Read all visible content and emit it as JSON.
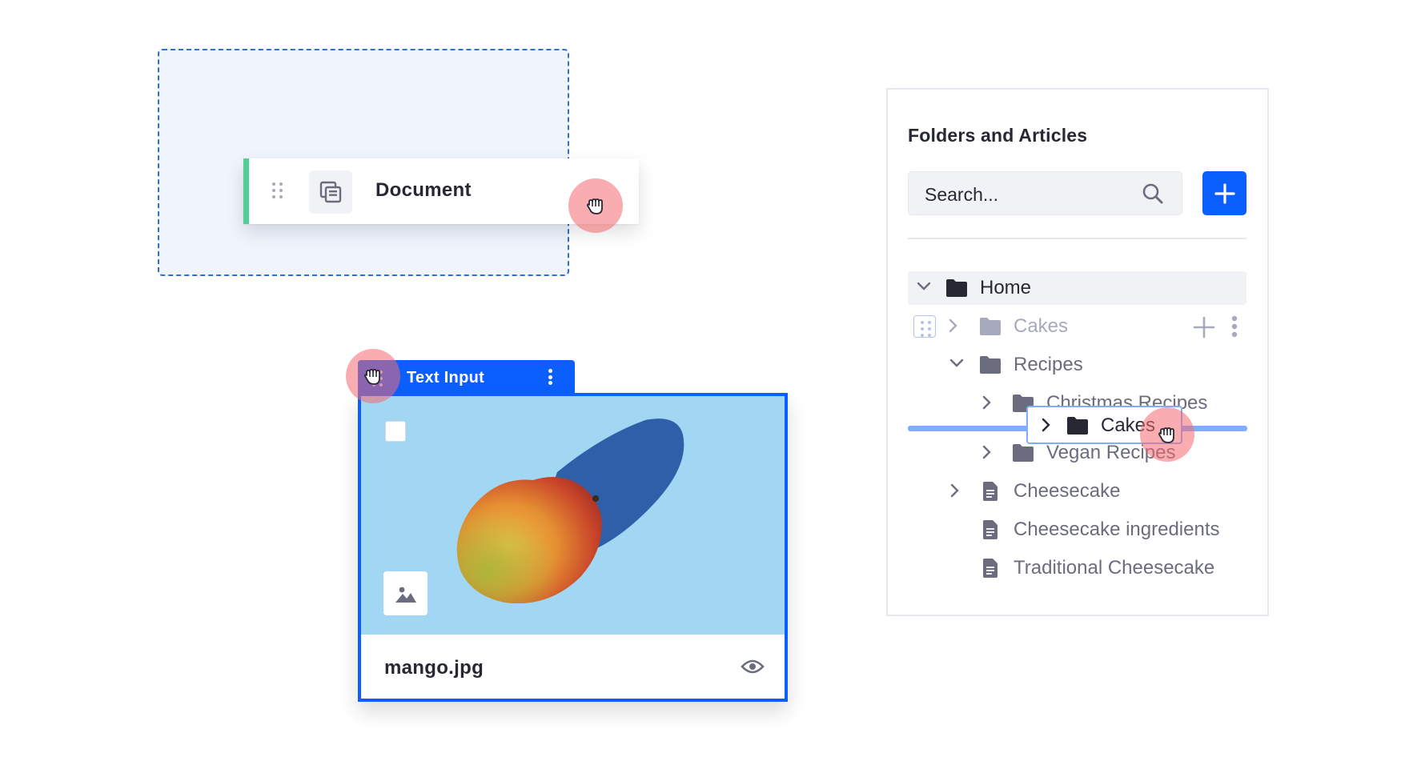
{
  "drop_zone": {
    "dragged_item": {
      "label": "Document",
      "icon": "stacked-documents-icon",
      "accent_color": "#4fce95"
    }
  },
  "image_field": {
    "toolbar": {
      "label": "Text Input",
      "drag_icon": "drag-handle-icon",
      "menu_icon": "kebab-menu-icon"
    },
    "file_name": "mango.jpg",
    "preview_icon": "eye-icon",
    "thumbnail_icon": "image-icon",
    "image_alt": "mango"
  },
  "folders_panel": {
    "title": "Folders and Articles",
    "search": {
      "placeholder": "Search..."
    },
    "add_button_icon": "plus-icon",
    "tree": [
      {
        "label": "Home",
        "type": "folder",
        "expanded": true
      },
      {
        "label": "Cakes",
        "type": "folder",
        "expanded": false,
        "state": "being-dragged"
      },
      {
        "label": "Recipes",
        "type": "folder",
        "expanded": true
      },
      {
        "label": "Christmas Recipes",
        "type": "folder",
        "expanded": false
      },
      {
        "label": "Vegan Recipes",
        "type": "folder",
        "expanded": false
      },
      {
        "label": "Cheesecake",
        "type": "article",
        "expanded": false
      },
      {
        "label": "Cheesecake ingredients",
        "type": "article"
      },
      {
        "label": "Traditional Cheesecake",
        "type": "article"
      }
    ],
    "drag_preview": {
      "label": "Cakes"
    }
  },
  "colors": {
    "primary": "#0b5fff",
    "drop_indicator": "#80acff",
    "cursor_halo": "#f46a70",
    "drop_zone_bg": "#eff4fd"
  }
}
